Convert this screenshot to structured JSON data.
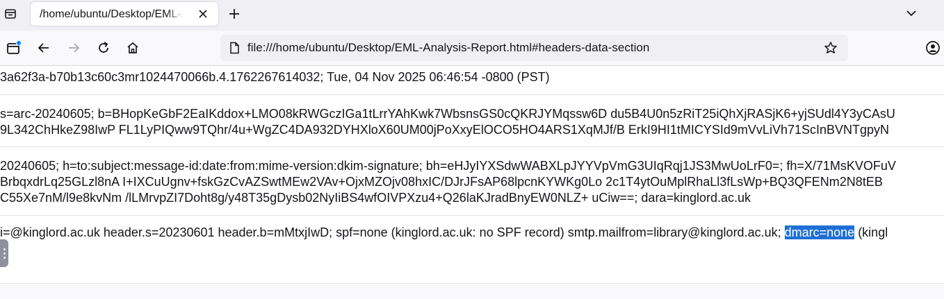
{
  "browser": {
    "tab": {
      "title": "/home/ubuntu/Desktop/EML-Analysis-Report.html"
    },
    "url": "file:///home/ubuntu/Desktop/EML-Analysis-Report.html#headers-data-section"
  },
  "content": {
    "rows": [
      {
        "lines": [
          "3a62f3a-b70b13c60c3mr1024470066b.4.1762267614032; Tue, 04 Nov 2025 06:46:54 -0800 (PST)"
        ]
      },
      {
        "lines": [
          "s=arc-20240605; b=BHopKeGbF2EaIKddox+LMO08kRWGczIGa1tLrrYAhKwk7WbsnsGS0cQKRJYMqssw6D du5B4U0n5zRiT25iQhXjRASjK6+yjSUdl4Y3yCAsU",
          "9L342ChHkeZ98IwP FL1LyPIQww9TQhr/4u+WgZC4DA932DYHXloX60UM00jPoXxyElOCO5HO4ARS1XqMJf/B ErkI9HI1tMICYSId9mVvLiVh71ScInBVNTgpyN"
        ]
      },
      {
        "lines": [
          "20240605; h=to:subject:message-id:date:from:mime-version:dkim-signature; bh=eHJyIYXSdwWABXLpJYYVpVmG3UIqRqj1JS3MwUoLrF0=; fh=X/71MsKVOFuV",
          "BrbqxdrLq25GLzl8nA I+IXCuUgnv+fskGzCvAZSwtMEw2VAv+OjxMZOjv08hxIC/DJrJFsAP68lpcnKYWKg0Lo 2c1T4ytOuMplRhaLl3fLsWp+BQ3QFENm2N8tEB",
          "C55Xe7nM/l9e8kvNm /lLMrvpZI7Doht8g/y48T35gDysb02NyIiBS4wfOIVPXzu4+Q26laKJradBnyEW0NLZ+ uCiw==; dara=kinglord.ac.uk"
        ]
      },
      {
        "before_selection": "i=@kinglord.ac.uk header.s=20230601 header.b=mMtxjIwD; spf=none (kinglord.ac.uk: no SPF record) smtp.mailfrom=library@kinglord.ac.uk; ",
        "selection": "dmarc=none",
        "after_selection": " (kingl"
      }
    ]
  }
}
